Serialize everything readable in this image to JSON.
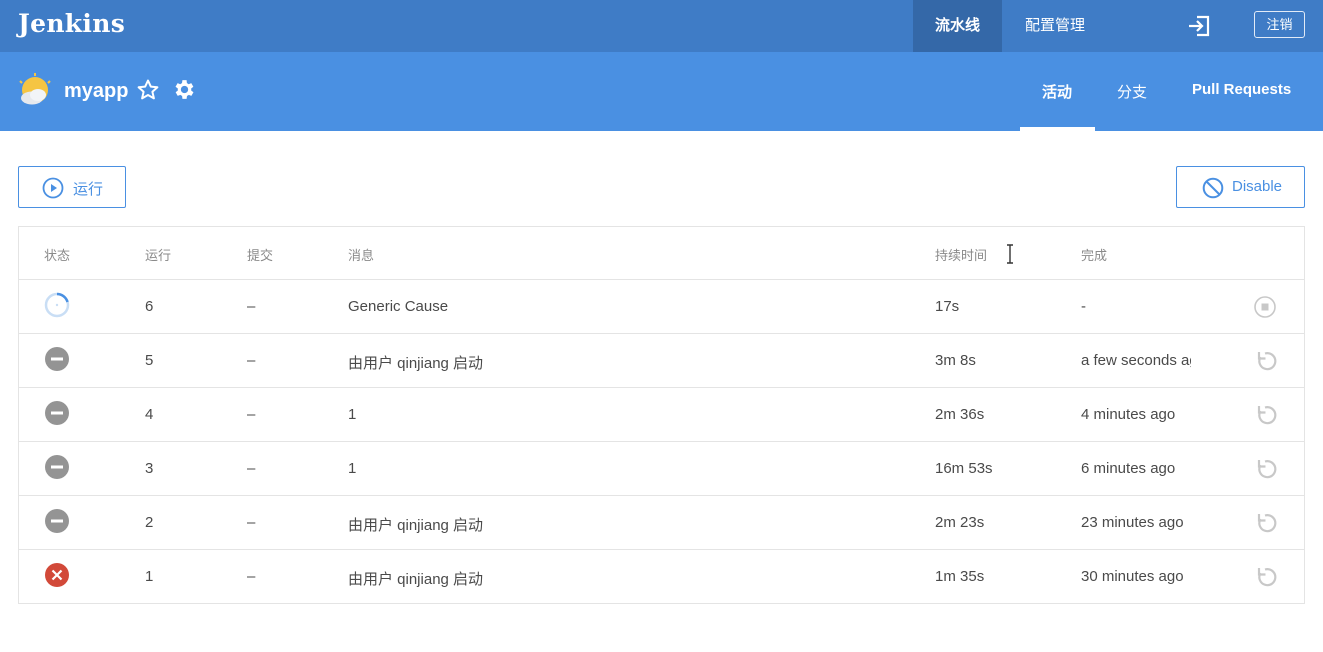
{
  "topbar": {
    "logo": "Jenkins",
    "nav": {
      "pipelines": "流水线",
      "administration": "配置管理"
    },
    "logout": "注销"
  },
  "subheader": {
    "app_name": "myapp",
    "tabs": {
      "activity": "活动",
      "branches": "分支",
      "pull_requests": "Pull Requests"
    }
  },
  "actions": {
    "run": "运行",
    "disable": "Disable"
  },
  "table": {
    "columns": {
      "status": "状态",
      "run": "运行",
      "commit": "提交",
      "message": "消息",
      "duration": "持续时间",
      "completed": "完成"
    },
    "rows": [
      {
        "status": "running",
        "run": "6",
        "commit": "–",
        "message": "Generic Cause",
        "duration": "17s",
        "completed": "-",
        "action": "stop"
      },
      {
        "status": "aborted",
        "run": "5",
        "commit": "–",
        "message": "由用户 qinjiang 启动",
        "duration": "3m 8s",
        "completed": "a few seconds ago",
        "action": "rerun"
      },
      {
        "status": "aborted",
        "run": "4",
        "commit": "–",
        "message": "1",
        "duration": "2m 36s",
        "completed": "4 minutes ago",
        "action": "rerun"
      },
      {
        "status": "aborted",
        "run": "3",
        "commit": "–",
        "message": "1",
        "duration": "16m 53s",
        "completed": "6 minutes ago",
        "action": "rerun"
      },
      {
        "status": "aborted",
        "run": "2",
        "commit": "–",
        "message": "由用户 qinjiang 启动",
        "duration": "2m 23s",
        "completed": "23 minutes ago",
        "action": "rerun"
      },
      {
        "status": "failed",
        "run": "1",
        "commit": "–",
        "message": "由用户 qinjiang 启动",
        "duration": "1m 35s",
        "completed": "30 minutes ago",
        "action": "rerun"
      }
    ]
  },
  "colors": {
    "topbar": "#3f7cc6",
    "subheader": "#4a90e2",
    "accent": "#4a90e2",
    "aborted": "#949494",
    "failed": "#d24939",
    "running": "#4a90e2"
  },
  "icons": {
    "weather": "partly-cloudy-weather-icon",
    "favorite": "star-outline-icon",
    "settings": "gear-icon",
    "login": "login-icon",
    "run": "play-circle-icon",
    "disable": "ban-icon",
    "stop": "stop-circle-icon",
    "rerun": "replay-icon"
  }
}
